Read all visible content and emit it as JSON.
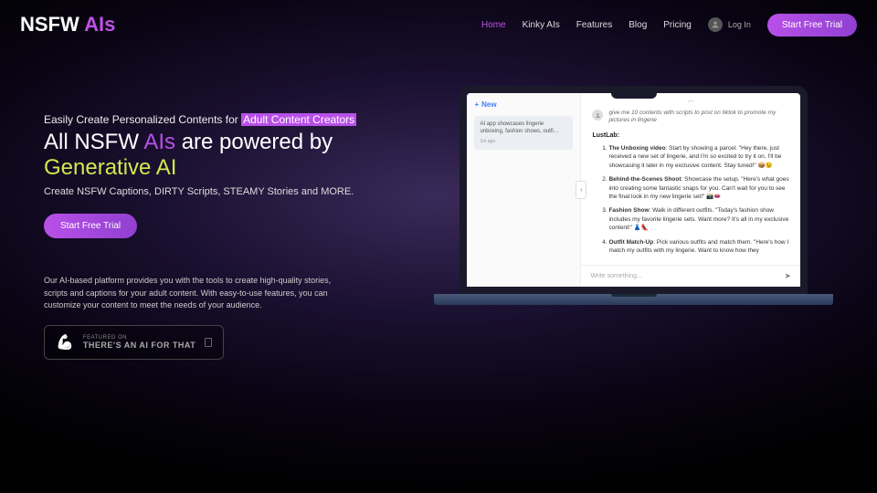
{
  "brand": {
    "part1": "NSFW ",
    "part2": "AIs"
  },
  "nav": {
    "home": "Home",
    "kinky": "Kinky AIs",
    "features": "Features",
    "blog": "Blog",
    "pricing": "Pricing",
    "login": "Log In",
    "cta": "Start Free Trial"
  },
  "hero": {
    "pre1": "Easily Create Personalized Contents for ",
    "pre1_hl": "Adult Content Creators",
    "h1_a": "All NSFW ",
    "h1_b": "AIs",
    "h1_c": " are powered by ",
    "h1_d": "Generative AI",
    "sub2": "Create NSFW Captions, DIRTY Scripts, STEAMY Stories and MORE.",
    "cta": "Start Free Trial",
    "desc": "Our AI-based platform provides you with the tools to create high-quality stories, scripts and captions for your adult content. With easy-to-use features, you can customize your content to meet the needs of your audience.",
    "badge_line1": "FEATURED ON",
    "badge_line2": "THERE'S AN AI FOR THAT"
  },
  "app": {
    "new": "New",
    "thread": "AI app showcases lingerie unboxing, fashion shows, outfi…",
    "thread_time": "1m ago",
    "user_msg": "give me 10 contents with scripts to post on tiktok to promote my pictures in lingerie",
    "bot_name": "LustLab:",
    "items": [
      {
        "title": "The Unboxing video",
        "body": ": Start by showing a parcel. \"Hey there, just received a new set of lingerie, and I'm so excited to try it on. I'll be showcasing it later in my exclusive content. Stay tuned!\" 📦😉"
      },
      {
        "title": "Behind-the-Scenes Shoot",
        "body": ": Showcase the setup. \"Here's what goes into creating some fantastic snaps for you. Can't wait for you to see the final look in my new lingerie set!\" 📸👄"
      },
      {
        "title": "Fashion Show",
        "body": ": Walk in different outfits. \"Today's fashion show includes my favorite lingerie sets. Want more? It's all in my exclusive content!\" 👗👠"
      },
      {
        "title": "Outfit Match-Up",
        "body": ": Pick various outfits and match them. \"Here's how I match my outfits with my lingerie. Want to know how they"
      }
    ],
    "composer_placeholder": "Write something..."
  }
}
